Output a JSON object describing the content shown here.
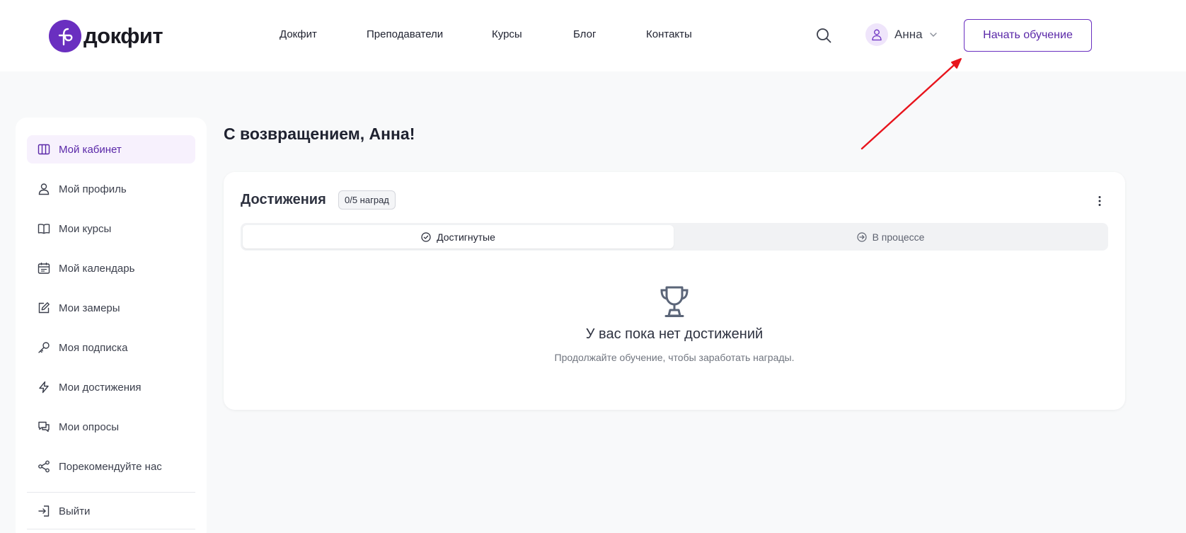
{
  "header": {
    "logo_text": "докфит",
    "nav": [
      {
        "label": "Докфит"
      },
      {
        "label": "Преподаватели"
      },
      {
        "label": "Курсы"
      },
      {
        "label": "Блог"
      },
      {
        "label": "Контакты"
      }
    ],
    "user_name": "Анна",
    "cta_label": "Начать обучение"
  },
  "sidebar": {
    "items": [
      {
        "label": "Мой кабинет",
        "icon": "columns-icon",
        "active": true
      },
      {
        "label": "Мой профиль",
        "icon": "user-icon"
      },
      {
        "label": "Мои курсы",
        "icon": "book-icon"
      },
      {
        "label": "Мой календарь",
        "icon": "calendar-icon"
      },
      {
        "label": "Мои замеры",
        "icon": "pencil-icon"
      },
      {
        "label": "Моя подписка",
        "icon": "key-icon"
      },
      {
        "label": "Мои достижения",
        "icon": "lightning-icon"
      },
      {
        "label": "Мои опросы",
        "icon": "chat-bubbles-icon"
      },
      {
        "label": "Порекомендуйте нас",
        "icon": "share-icon"
      }
    ],
    "logout_label": "Выйти"
  },
  "main": {
    "welcome": "С возвращением, Анна!",
    "achievements": {
      "title": "Достижения",
      "badge": "0/5 наград",
      "tabs": [
        {
          "label": "Достигнутые",
          "icon": "check-circle-icon",
          "active": true
        },
        {
          "label": "В процессе",
          "icon": "arrow-circle-icon"
        }
      ],
      "empty_title": "У вас пока нет достижений",
      "empty_subtitle": "Продолжайте обучение, чтобы заработать награды.",
      "empty_icon": "trophy-icon"
    }
  },
  "colors": {
    "accent": "#6a2fc0",
    "active_bg": "#f7f1fd",
    "annotation": "#e8141c"
  }
}
